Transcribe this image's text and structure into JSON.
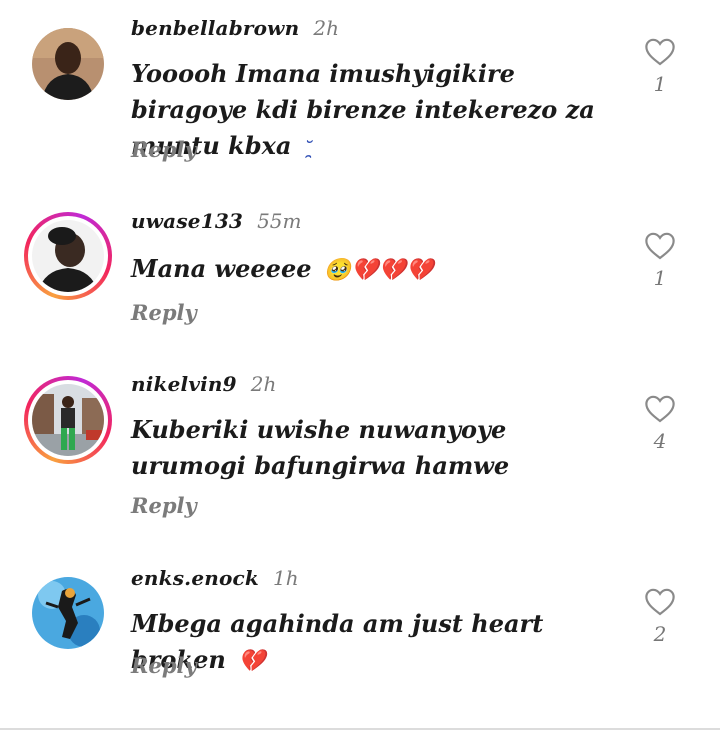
{
  "comments": [
    {
      "username": "benbellabrown",
      "time": "2h",
      "text": "Yooooh Imana imushyigikire biragoye kdi birenze intekerezo za muntu kbxa ",
      "text_emoji": "˘̯",
      "reply": "Reply",
      "likes": "1",
      "avatar": "person-dark-shirt",
      "story_ring": false
    },
    {
      "username": "uwase133",
      "time": "55m",
      "text": "Mana weeeee ",
      "text_emoji": "🥹💔💔💔",
      "reply": "Reply",
      "likes": "1",
      "avatar": "woman-portrait",
      "story_ring": true
    },
    {
      "username": "nikelvin9",
      "time": "2h",
      "text": "Kuberiki  uwishe nuwanyoye urumogi bafungirwa hamwe",
      "text_emoji": "",
      "reply": "Reply",
      "likes": "4",
      "avatar": "man-street",
      "story_ring": true
    },
    {
      "username": "enks.enock",
      "time": "1h",
      "text": "Mbega agahinda am just heart broken ",
      "text_emoji": "💔",
      "reply": "Reply",
      "likes": "2",
      "avatar": "graffiti-figure",
      "story_ring": false
    }
  ],
  "colors": {
    "story_ring": [
      "#f9a03f",
      "#f2255d",
      "#c02ad6"
    ],
    "muted": "#7a7a7a",
    "heart_red": "#d0021b"
  },
  "icons": {
    "like": "heart-outline-icon"
  }
}
